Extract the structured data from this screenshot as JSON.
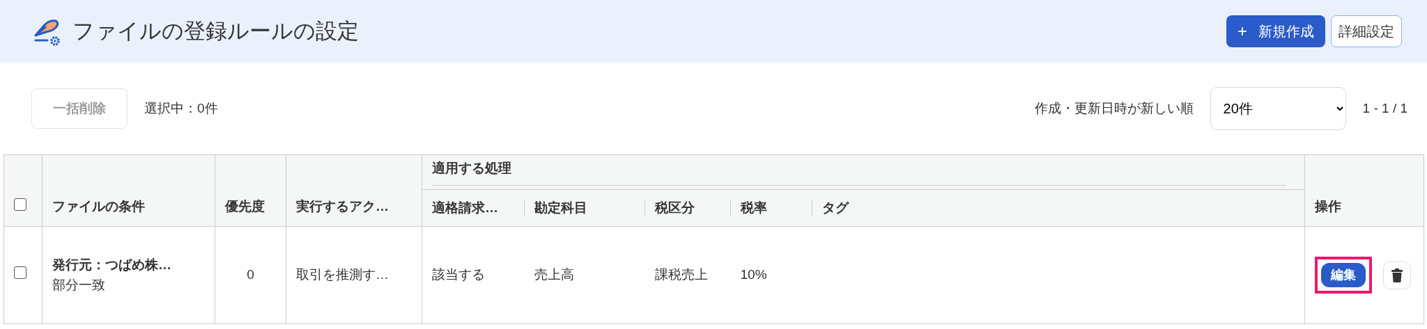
{
  "header": {
    "title": "ファイルの登録ルールの設定",
    "new_button": {
      "icon": "+",
      "label": "新規作成"
    },
    "settings_button": {
      "label": "詳細設定"
    }
  },
  "toolbar": {
    "bulk_delete": {
      "label": "一括削除",
      "disabled": true
    },
    "selection_count": "選択中：0件",
    "sort_label": "作成・更新日時が新しい順",
    "per_page": {
      "value": "20件"
    },
    "pagination": "1 - 1 / 1"
  },
  "table": {
    "select_all": {
      "checked": false
    },
    "columns": [
      {
        "label": "ファイルの条件"
      },
      {
        "label": "優先度"
      },
      {
        "label": "実行するアク…"
      }
    ],
    "group_header": "適用する処理",
    "group_columns": [
      {
        "label": "適格請求…"
      },
      {
        "label": "勘定科目"
      },
      {
        "label": "税区分"
      },
      {
        "label": "税率"
      },
      {
        "label": "タグ"
      }
    ],
    "actions_column": "操作",
    "rows": [
      {
        "checked": false,
        "condition": "発行元：つばめ株…",
        "condition_match": "部分一致",
        "priority": "0",
        "action": "取引を推測す…",
        "values": [
          "該当する",
          "売上高",
          "課税売上",
          "10%"
        ],
        "edit_label": "編集",
        "edit_highlighted": true
      }
    ]
  }
}
